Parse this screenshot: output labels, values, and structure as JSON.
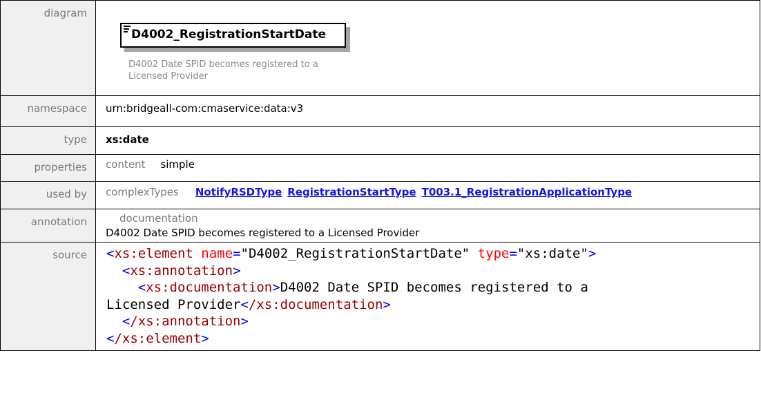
{
  "rows": {
    "diagram": {
      "label": "diagram",
      "element_name": "D4002_RegistrationStartDate",
      "element_doc": "D4002 Date SPID becomes registered to a Licensed Provider"
    },
    "namespace": {
      "label": "namespace",
      "value": "urn:bridgeall-com:cmaservice:data:v3"
    },
    "type": {
      "label": "type",
      "value": "xs:date"
    },
    "properties": {
      "label": "properties",
      "key": "content",
      "value": "simple"
    },
    "used_by": {
      "label": "used by",
      "key": "complexTypes",
      "links": [
        "NotifyRSDType",
        "RegistrationStartType",
        "T003.1_RegistrationApplicationType"
      ]
    },
    "annotation": {
      "label": "annotation",
      "key": "documentation",
      "value": "D4002 Date SPID becomes registered to a Licensed Provider"
    },
    "source": {
      "label": "source",
      "open_tag": "xs:element",
      "attr_name": "name",
      "attr_name_value": "\"D4002_RegistrationStartDate\"",
      "attr_type": "type",
      "attr_type_value": "\"xs:date\"",
      "annotation_tag": "xs:annotation",
      "documentation_tag": "xs:documentation",
      "documentation_text_1": "D4002 Date SPID becomes registered to a",
      "documentation_text_2": "Licensed Provider",
      "close_documentation": "/xs:documentation",
      "close_annotation": "/xs:annotation",
      "close_element": "/xs:element"
    }
  },
  "colors": {
    "label_background": "#f0f0f0",
    "link": "#1515e8",
    "xml_tag": "#980000",
    "xml_attr": "#ff0000",
    "xml_bracket": "#0000ff"
  }
}
